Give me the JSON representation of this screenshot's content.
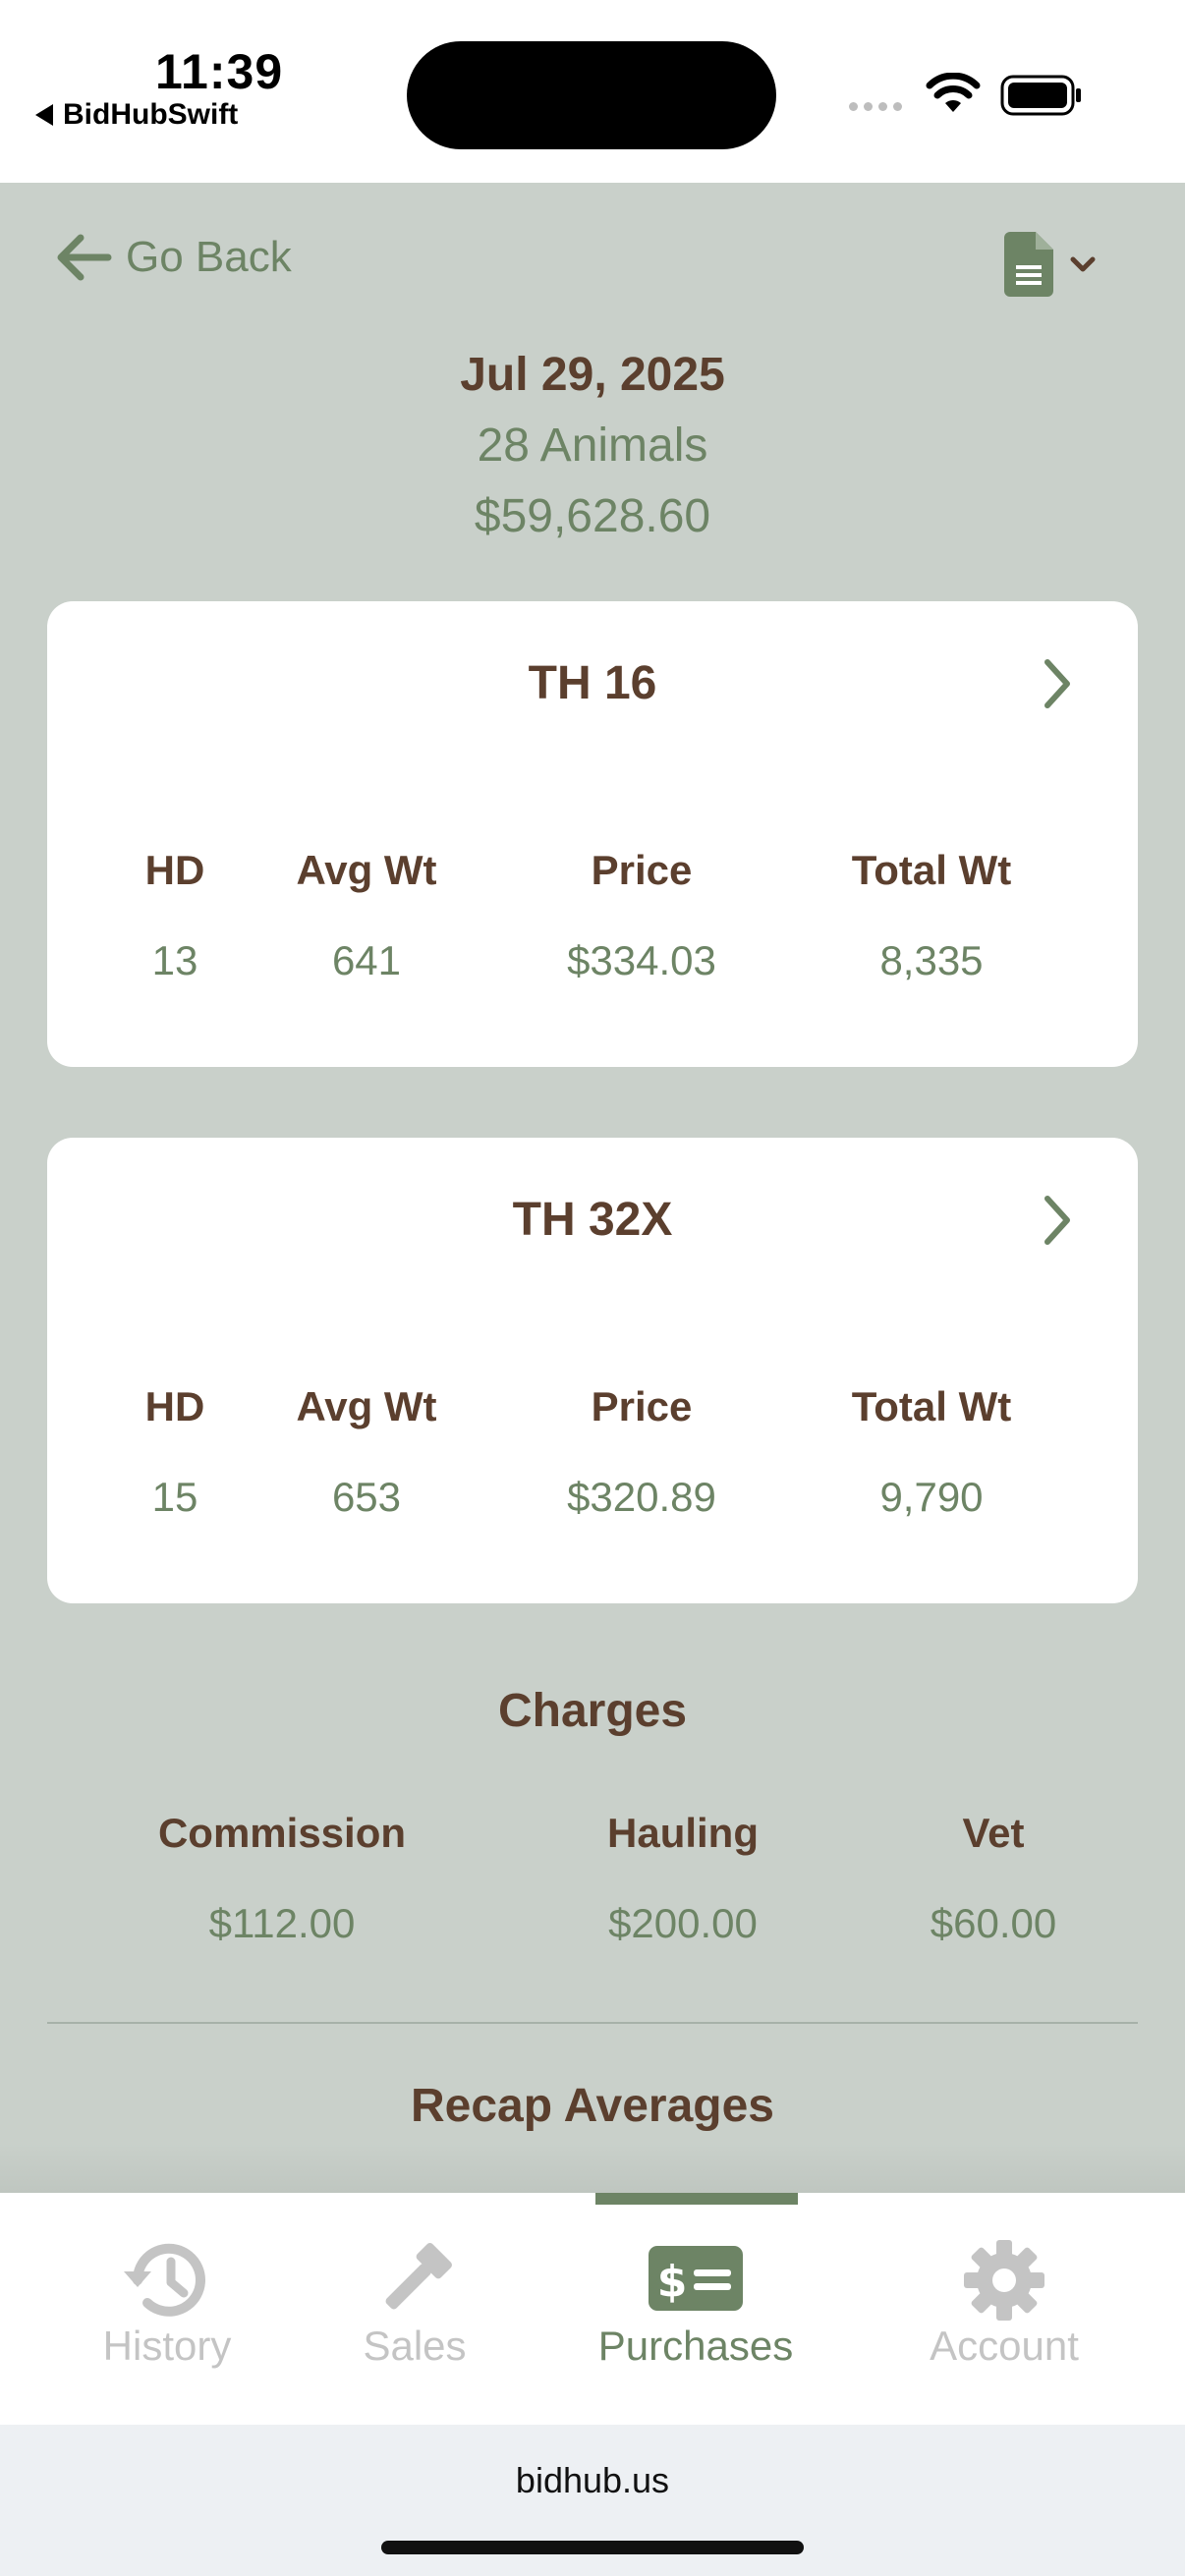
{
  "status_bar": {
    "time": "11:39",
    "back_app": "BidHubSwift"
  },
  "header": {
    "back_label": "Go Back",
    "date": "Jul 29, 2025",
    "animals": "28 Animals",
    "total": "$59,628.60"
  },
  "lots": [
    {
      "title": "TH 16",
      "headers": [
        "HD",
        "Avg Wt",
        "Price",
        "Total Wt"
      ],
      "values": [
        "13",
        "641",
        "$334.03",
        "8,335"
      ]
    },
    {
      "title": "TH 32X",
      "headers": [
        "HD",
        "Avg Wt",
        "Price",
        "Total Wt"
      ],
      "values": [
        "15",
        "653",
        "$320.89",
        "9,790"
      ]
    }
  ],
  "charges": {
    "title": "Charges",
    "items": [
      {
        "label": "Commission",
        "value": "$112.00"
      },
      {
        "label": "Hauling",
        "value": "$200.00"
      },
      {
        "label": "Vet",
        "value": "$60.00"
      }
    ]
  },
  "recap": {
    "title": "Recap Averages"
  },
  "tabs": [
    {
      "label": "History",
      "icon": "history-icon",
      "active": false
    },
    {
      "label": "Sales",
      "icon": "gavel-icon",
      "active": false
    },
    {
      "label": "Purchases",
      "icon": "money-bill-icon",
      "active": true
    },
    {
      "label": "Account",
      "icon": "gear-icon",
      "active": false
    }
  ],
  "browser": {
    "url": "bidhub.us"
  },
  "colors": {
    "background": "#c9d0ca",
    "brown_text": "#5b3f2e",
    "green_text": "#6d8465",
    "inactive_tab": "#c4c4c4"
  }
}
